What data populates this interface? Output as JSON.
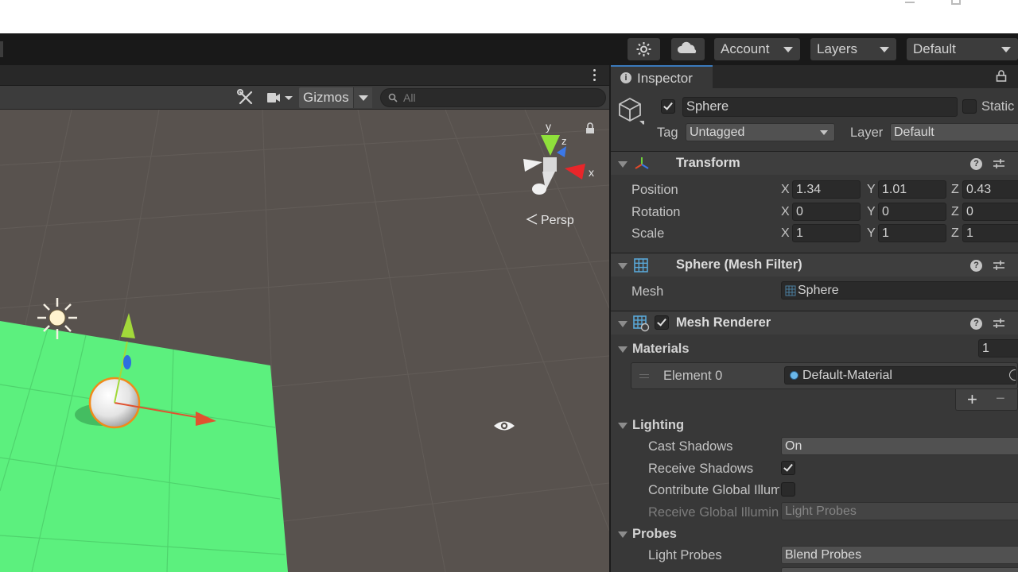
{
  "toolbar": {
    "account_label": "Account",
    "layers_label": "Layers",
    "layout_label": "Default"
  },
  "scene": {
    "gizmos_label": "Gizmos",
    "search_placeholder": "All",
    "axis_y": "y",
    "axis_x": "x",
    "axis_z": "z",
    "persp_label": "Persp"
  },
  "inspector": {
    "tab_label": "Inspector",
    "object_name": "Sphere",
    "static_label": "Static",
    "tag_label": "Tag",
    "tag_value": "Untagged",
    "layer_label": "Layer",
    "layer_value": "Default",
    "transform": {
      "title": "Transform",
      "position_label": "Position",
      "rotation_label": "Rotation",
      "scale_label": "Scale",
      "axis_x": "X",
      "axis_y": "Y",
      "axis_z": "Z",
      "position": {
        "x": "1.34",
        "y": "1.01",
        "z": "0.43"
      },
      "rotation": {
        "x": "0",
        "y": "0",
        "z": "0"
      },
      "scale": {
        "x": "1",
        "y": "1",
        "z": "1"
      }
    },
    "mesh_filter": {
      "title": "Sphere (Mesh Filter)",
      "mesh_label": "Mesh",
      "mesh_value": "Sphere"
    },
    "mesh_renderer": {
      "title": "Mesh Renderer",
      "materials_label": "Materials",
      "materials_count": "1",
      "element_label": "Element 0",
      "element_value": "Default-Material",
      "add_label": "+",
      "remove_label": "−",
      "lighting_label": "Lighting",
      "cast_shadows_label": "Cast Shadows",
      "cast_shadows_value": "On",
      "receive_shadows_label": "Receive Shadows",
      "contribute_gi_label": "Contribute Global Illumination",
      "receive_gi_label": "Receive Global Illumination",
      "receive_gi_value": "Light Probes",
      "probes_label": "Probes",
      "light_probes_label": "Light Probes",
      "light_probes_value": "Blend Probes"
    }
  },
  "colors": {
    "viewport_bg": "#58524e",
    "plane_green": "#5cf07e",
    "panel_bg": "#383838",
    "accent_blue": "#3a79bb"
  }
}
